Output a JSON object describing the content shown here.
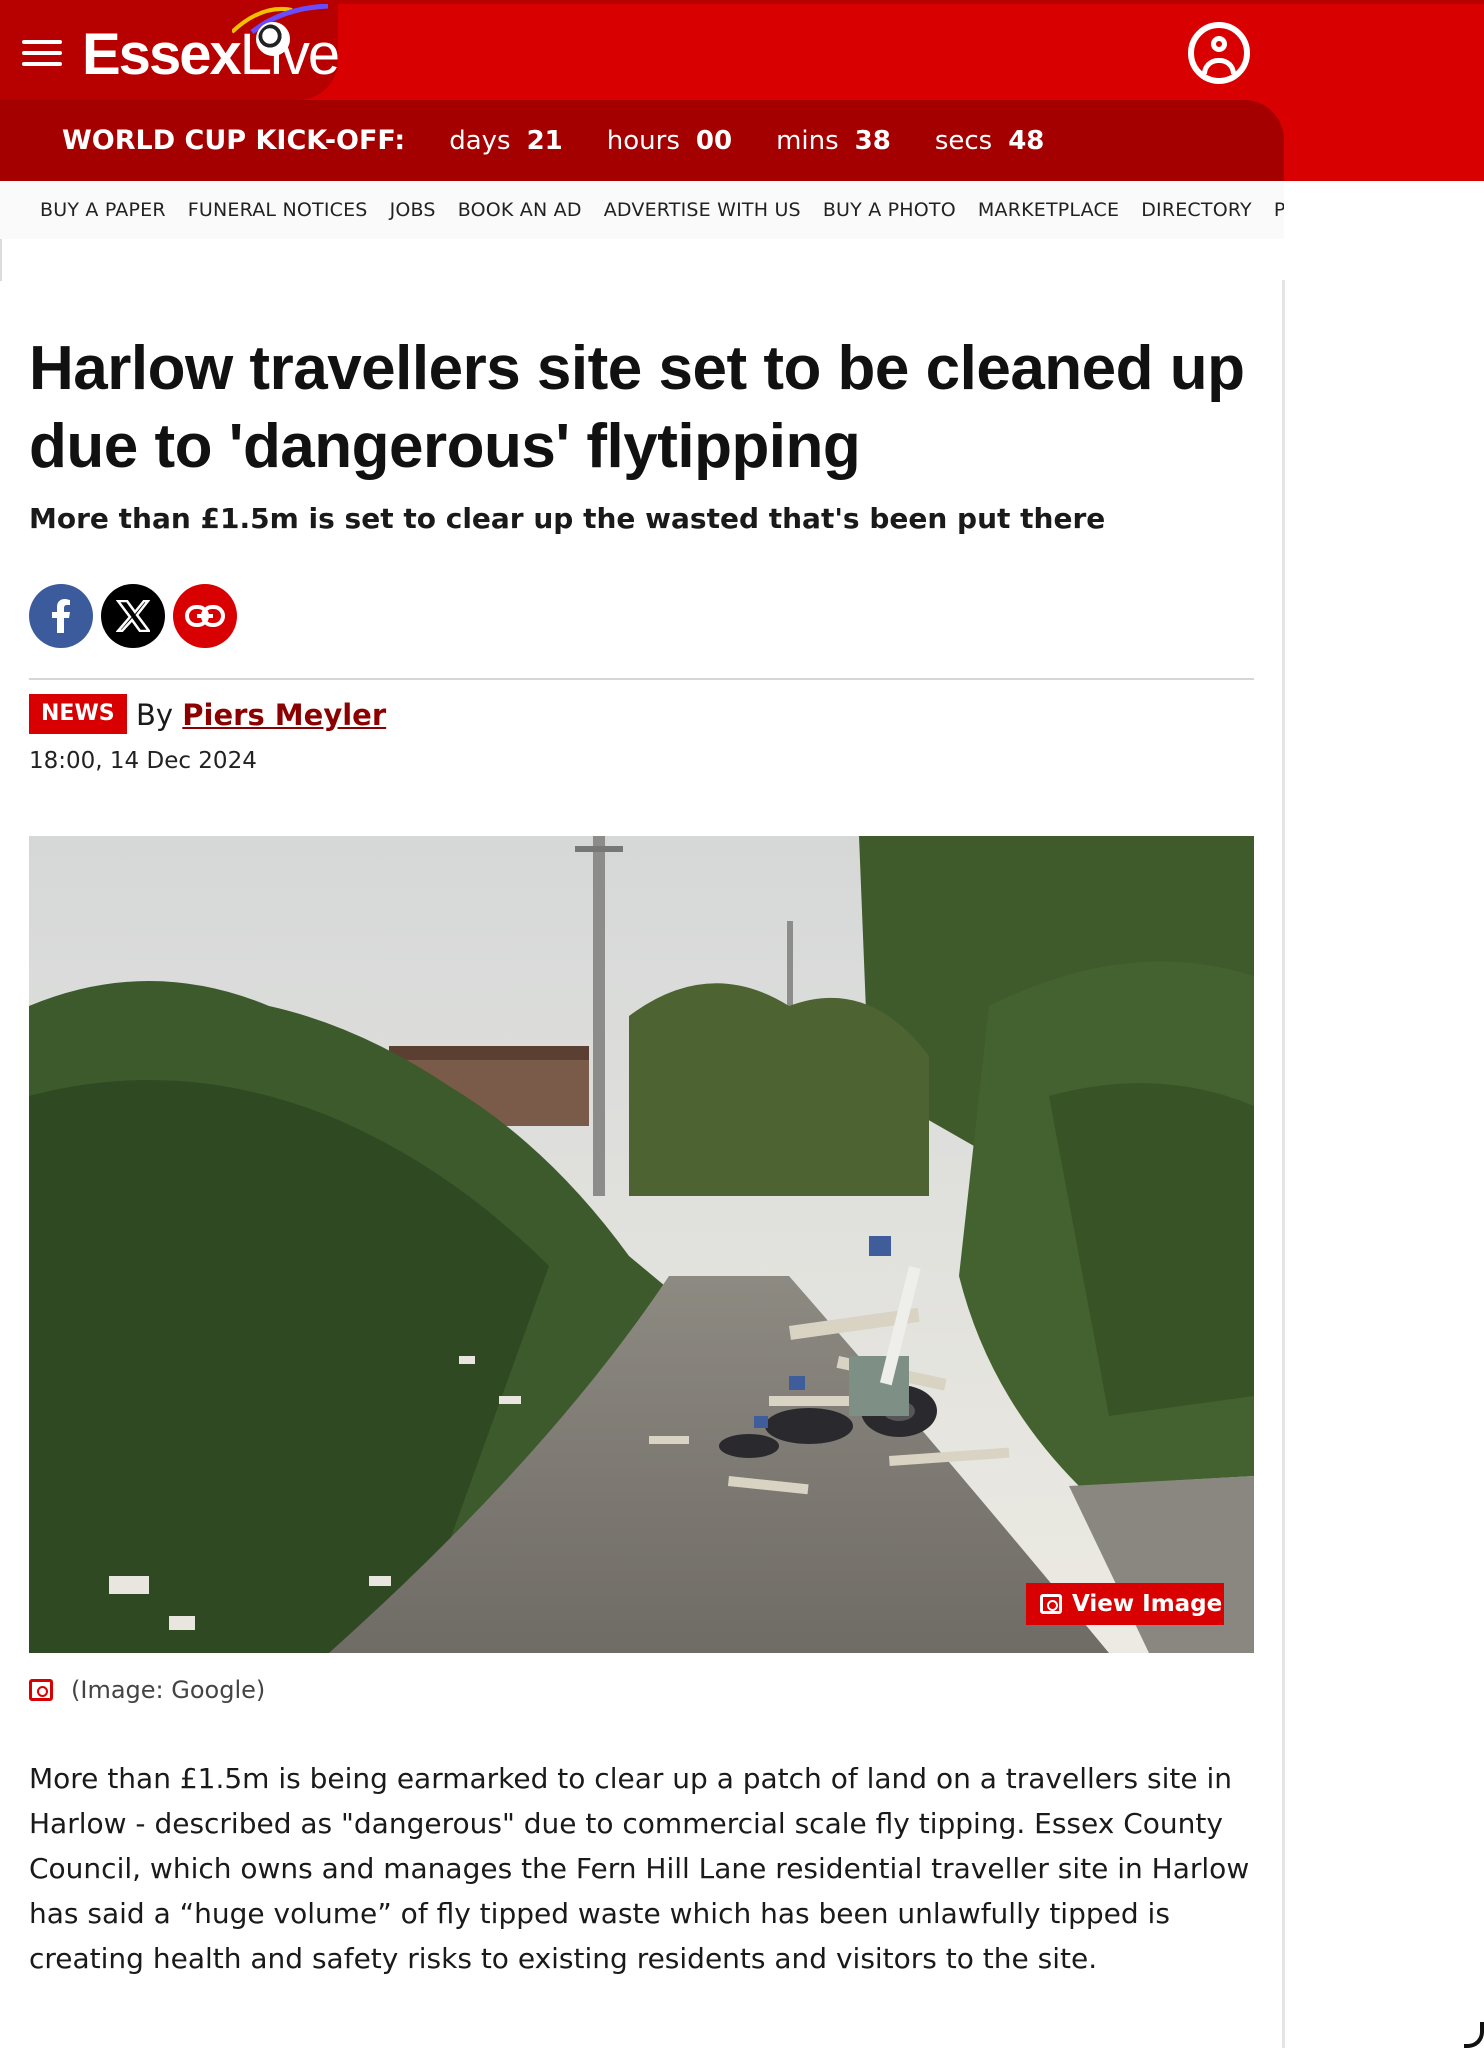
{
  "header": {
    "logo_main": "Essex",
    "logo_live": "Live",
    "countdown_label": "WORLD CUP KICK-OFF:",
    "countdown": [
      {
        "unit": "days",
        "value": "21"
      },
      {
        "unit": "hours",
        "value": "00"
      },
      {
        "unit": "mins",
        "value": "38"
      },
      {
        "unit": "secs",
        "value": "48"
      }
    ],
    "colors": {
      "brand_red": "#d80000",
      "dark_red": "#a50000"
    }
  },
  "nav": {
    "items": [
      "BUY A PAPER",
      "FUNERAL NOTICES",
      "JOBS",
      "BOOK AN AD",
      "ADVERTISE WITH US",
      "BUY A PHOTO",
      "MARKETPLACE",
      "DIRECTORY",
      "PUB"
    ]
  },
  "article": {
    "headline": "Harlow travellers site set to be cleaned up due to 'dangerous' flytipping",
    "subhead": "More than £1.5m is set to clear up the wasted that's been put there",
    "share_icons": [
      "facebook-icon",
      "x-icon",
      "link-icon"
    ],
    "badge": "NEWS",
    "by": "By",
    "author": "Piers Meyler",
    "date": "18:00, 14 Dec 2024",
    "view_image": "View Image",
    "caption": "(Image: Google)",
    "body": "More than £1.5m is being earmarked to clear up a patch of land on a travellers site in Harlow - described as \"dangerous\" due to commercial scale fly tipping. Essex County Council, which owns and manages the Fern Hill Lane residential traveller site in Harlow has said a “huge volume” of fly tipped waste which has been unlawfully tipped is creating health and safety risks to existing residents and visitors to the site."
  }
}
